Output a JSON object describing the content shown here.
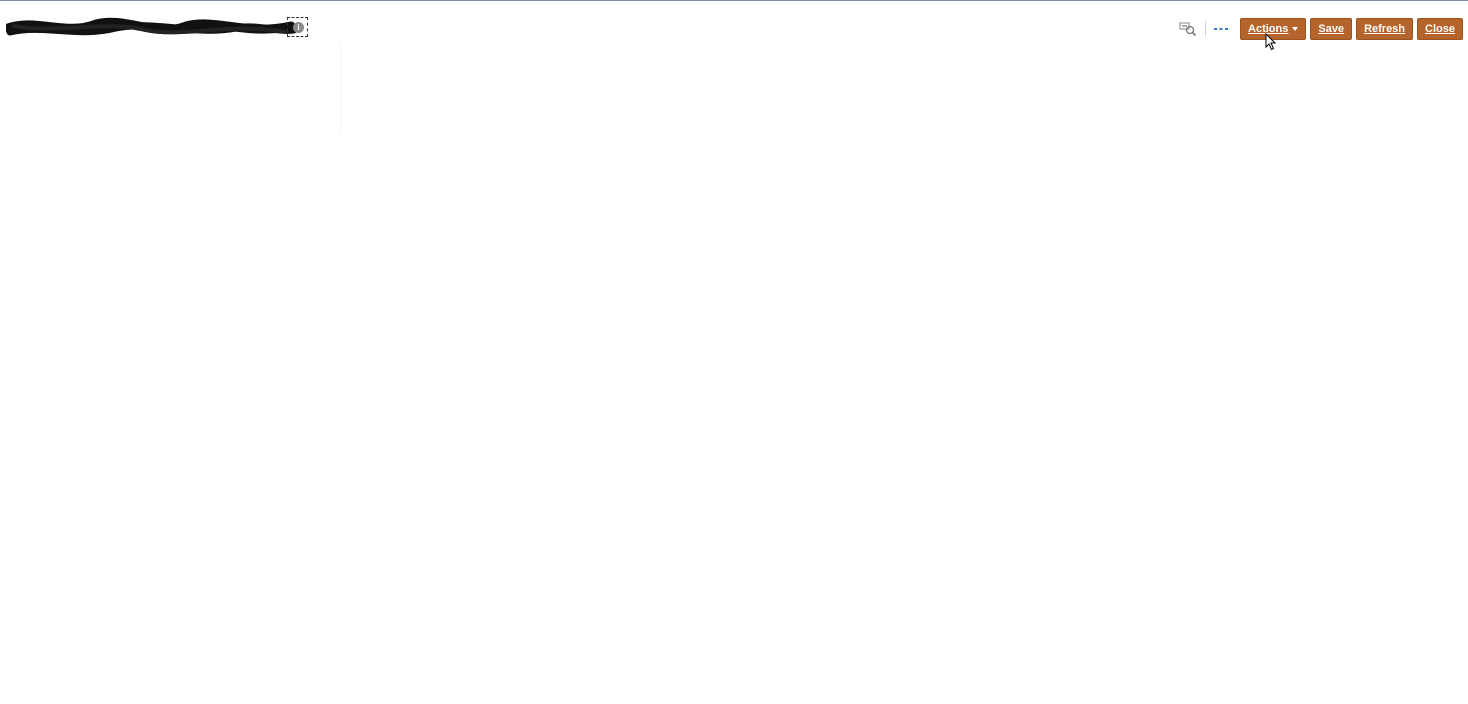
{
  "header": {
    "title_redacted": true,
    "info_icon": "info-icon"
  },
  "toolbar": {
    "search_icon": "search-glasses-icon",
    "more_icon": "more-ellipsis-icon",
    "actions_label": "Actions",
    "save_label": "Save",
    "refresh_label": "Refresh",
    "close_label": "Close"
  },
  "colors": {
    "button_bg": "#b5652b",
    "button_text": "#ffffff",
    "accent_blue": "#3a7bd5"
  }
}
